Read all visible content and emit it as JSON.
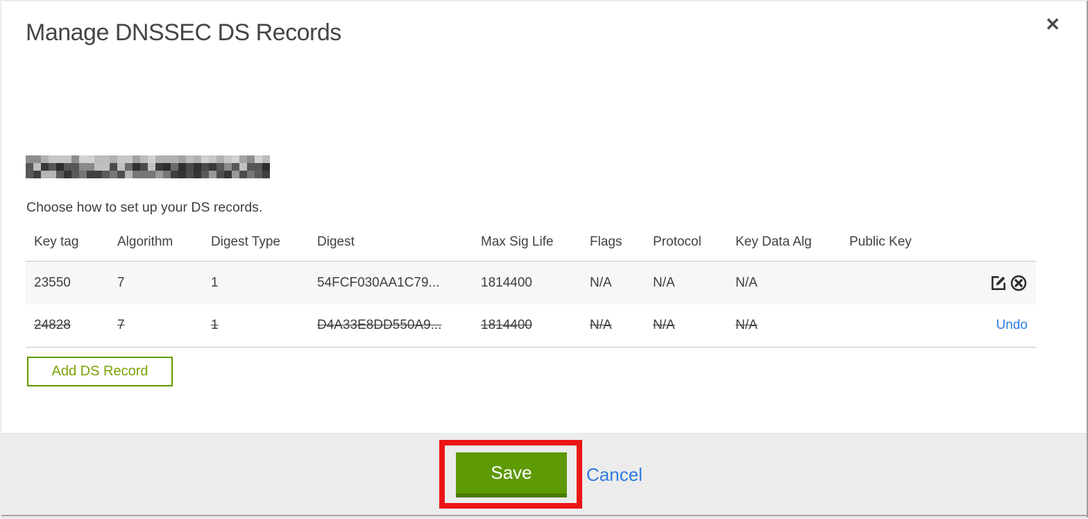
{
  "modal": {
    "title": "Manage DNSSEC DS Records",
    "close_glyph": "✕"
  },
  "domain": {
    "redacted": true
  },
  "intro": "Choose how to set up your DS records.",
  "table": {
    "columns": [
      "Key tag",
      "Algorithm",
      "Digest Type",
      "Digest",
      "Max Sig Life",
      "Flags",
      "Protocol",
      "Key Data Alg",
      "Public Key"
    ],
    "rows": [
      {
        "cells": [
          "23550",
          "7",
          "1",
          "54FCF030AA1C79...",
          "1814400",
          "N/A",
          "N/A",
          "N/A",
          ""
        ],
        "deleted": false,
        "actions": [
          "edit",
          "delete"
        ]
      },
      {
        "cells": [
          "24828",
          "7",
          "1",
          "D4A33E8DD550A9...",
          "1814400",
          "N/A",
          "N/A",
          "N/A",
          ""
        ],
        "deleted": true,
        "actions": [
          "undo"
        ]
      }
    ]
  },
  "buttons": {
    "add_ds_record": "Add DS Record",
    "save": "Save",
    "cancel": "Cancel",
    "undo": "Undo"
  },
  "icons": {
    "edit": "edit-icon",
    "delete": "delete-icon",
    "close": "close-icon"
  },
  "colors": {
    "button_green": "#5d9a04",
    "button_green_dark": "#4b7d00",
    "outline_green": "#5e9b02",
    "green_text": "#79a203",
    "link_blue": "#2e7ce0",
    "annotation_red": "#ec1414",
    "footer_gray": "#ececec",
    "row_stripe": "#f7f7f7"
  },
  "redacted_palettes": [
    [
      "#d2d2d2",
      "#bdbdbd",
      "#a3a3a3",
      "#8e8e8e",
      "#c7c7c7",
      "#b1b1b1"
    ],
    [
      "#2e2e2e",
      "#4a4a4a",
      "#383838",
      "#6b6b6b",
      "#575757",
      "#8a8a8a",
      "#c0c0c0",
      "#303030"
    ],
    [
      "#3f3f3f",
      "#5a5a5a",
      "#777777",
      "#4d4d4d",
      "#999999",
      "#343434",
      "#b5b5b5"
    ]
  ]
}
